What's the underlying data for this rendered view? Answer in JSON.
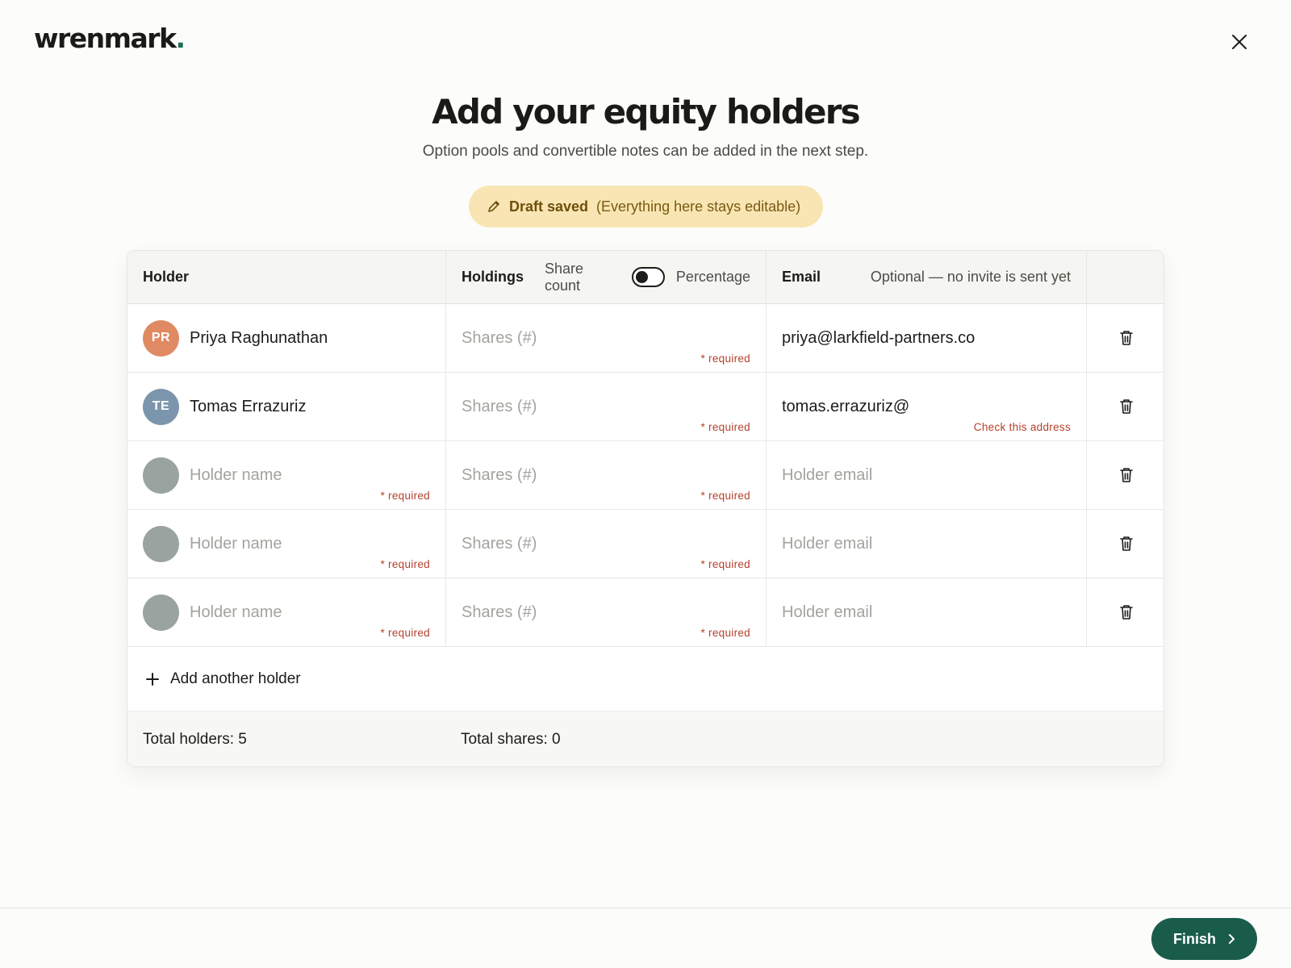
{
  "brand": {
    "name": "wrenmark",
    "dot": "."
  },
  "page": {
    "title": "Add your equity holders",
    "subtitle": "Option pools and convertible notes can be added in the next step."
  },
  "draft": {
    "status": "Draft saved",
    "note": "(Everything here stays editable)"
  },
  "table": {
    "headers": {
      "holder": "Holder",
      "holdings": "Holdings",
      "toggle_left": "Share count",
      "toggle_right": "Percentage",
      "email": "Email",
      "email_note": "Optional — no invite is sent yet"
    },
    "holdings_mode": "Share count",
    "rows": [
      {
        "initials": "PR",
        "avatar_color": "#e08a63",
        "name": "Priya Raghunathan",
        "name_placeholder": "Holder name",
        "name_hint": "",
        "shares": "",
        "shares_placeholder": "Shares (#)",
        "shares_hint": "* required",
        "email": "priya@larkfield-partners.co",
        "email_placeholder": "Holder email",
        "email_hint": ""
      },
      {
        "initials": "TE",
        "avatar_color": "#7b96ac",
        "name": "Tomas Errazuriz",
        "name_placeholder": "Holder name",
        "name_hint": "",
        "shares": "",
        "shares_placeholder": "Shares (#)",
        "shares_hint": "* required",
        "email": "tomas.errazuriz@",
        "email_placeholder": "Holder email",
        "email_hint": "Check this address"
      },
      {
        "initials": "",
        "avatar_color": "#99a39f",
        "name": "",
        "name_placeholder": "Holder name",
        "name_hint": "* required",
        "shares": "",
        "shares_placeholder": "Shares (#)",
        "shares_hint": "* required",
        "email": "",
        "email_placeholder": "Holder email",
        "email_hint": ""
      },
      {
        "initials": "",
        "avatar_color": "#99a39f",
        "name": "",
        "name_placeholder": "Holder name",
        "name_hint": "* required",
        "shares": "",
        "shares_placeholder": "Shares (#)",
        "shares_hint": "* required",
        "email": "",
        "email_placeholder": "Holder email",
        "email_hint": ""
      },
      {
        "initials": "",
        "avatar_color": "#99a39f",
        "name": "",
        "name_placeholder": "Holder name",
        "name_hint": "* required",
        "shares": "",
        "shares_placeholder": "Shares (#)",
        "shares_hint": "* required",
        "email": "",
        "email_placeholder": "Holder email",
        "email_hint": ""
      }
    ],
    "add_label": "Add another holder",
    "totals": {
      "holders": "Total holders: 5",
      "shares": "Total shares: 0"
    }
  },
  "footer": {
    "finish_label": "Finish"
  },
  "icons": {
    "close": "close-icon",
    "pencil": "pencil-icon",
    "trash": "trash-icon",
    "plus": "plus-icon",
    "chevron": "chevron-right-icon"
  },
  "colors": {
    "brand_green": "#1a5c4a",
    "draft_bg": "#f8e5b3",
    "error_red": "#b3412c"
  }
}
